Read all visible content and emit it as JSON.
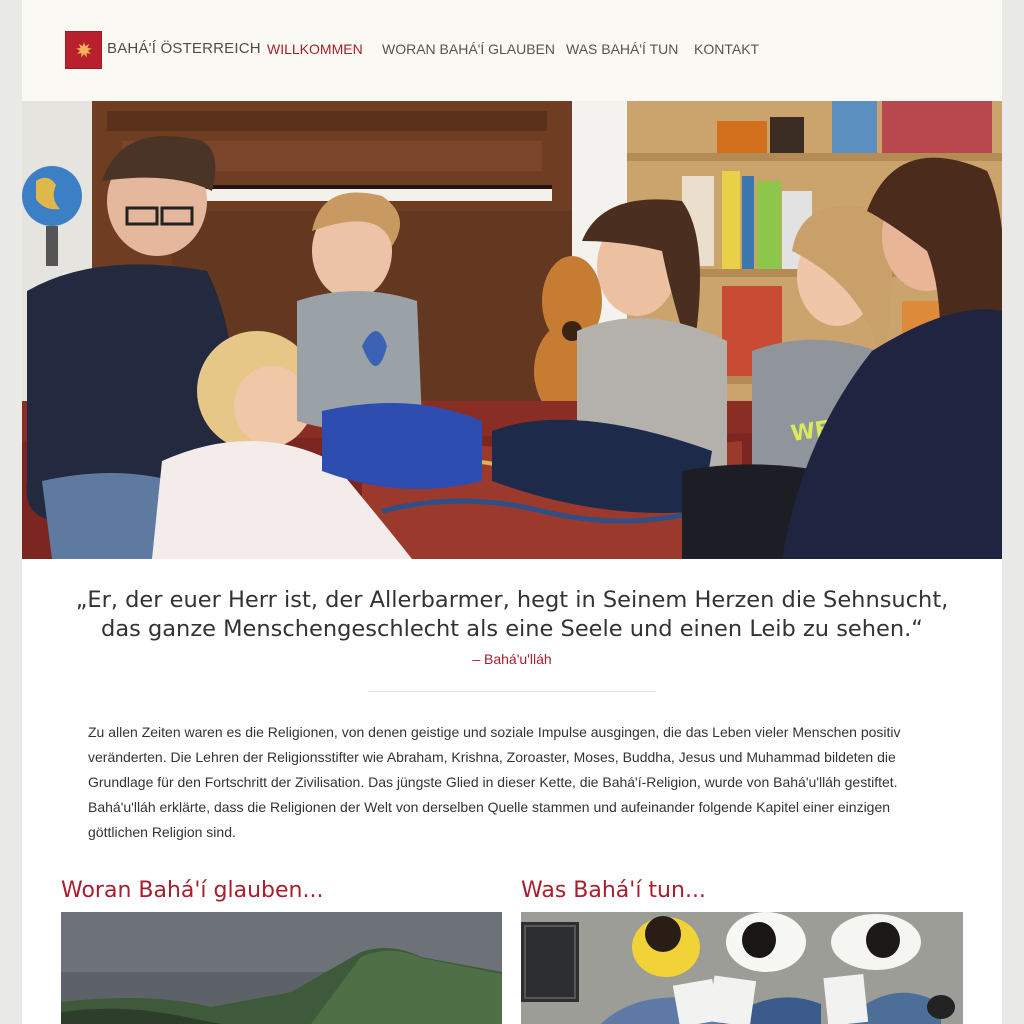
{
  "header": {
    "brand": "BAHÁ'Í ÖSTERREICH",
    "logo_icon": "nine-pointed-star-icon",
    "nav": [
      {
        "label": "WILLKOMMEN",
        "active": true
      },
      {
        "label": "WORAN BAHÁ'Í GLAUBEN",
        "active": false
      },
      {
        "label": "WAS BAHÁ'Í TUN",
        "active": false
      },
      {
        "label": "KONTAKT",
        "active": false
      }
    ]
  },
  "quote": {
    "line1": "„Er, der euer Herr ist, der Allerbarmer, hegt in Seinem Herzen die Sehnsucht,",
    "line2": "das ganze Menschengeschlecht als eine Seele und einen Leib zu sehen.“",
    "attribution": "– Bahá'u'lláh"
  },
  "intro": {
    "lines": [
      "Zu allen Zeiten waren es die Religionen, von denen geistige und soziale Impulse ausgingen, die das Leben vieler Menschen positiv",
      "veränderten. Die Lehren der Religionsstifter wie Abraham, Krishna, Zoroaster, Moses, Buddha, Jesus und Muhammad bildeten die",
      "Grundlage für den Fortschritt der Zivilisation. Das jüngste Glied in dieser Kette, die Bahá'í-Religion, wurde von Bahá'u'lláh gestiftet.",
      "Bahá'u'lláh erklärte, dass die Religionen der Welt von derselben Quelle stammen und aufeinander folgende Kapitel einer einzigen",
      "göttlichen Religion sind."
    ]
  },
  "sections": {
    "left_title": "Woran Bahá'í glauben...",
    "right_title": "Was Bahá'í tun..."
  },
  "colors": {
    "accent": "#a81e2d",
    "header_bg": "#fbf9f4",
    "text": "#333333"
  }
}
